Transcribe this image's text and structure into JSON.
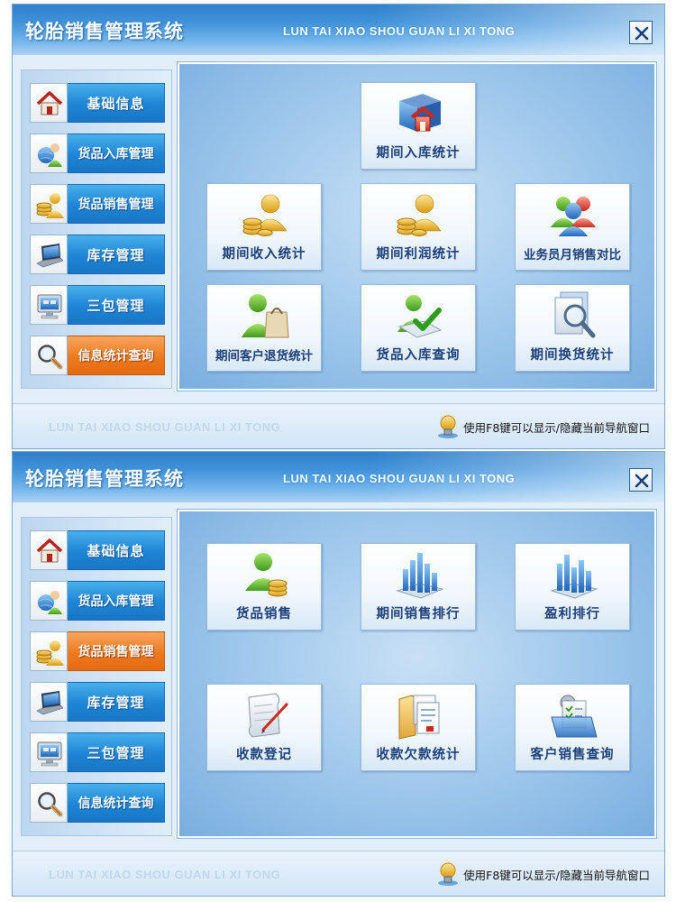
{
  "app": {
    "title": "轮胎销售管理系统",
    "subtitle": "LUN TAI XIAO SHOU GUAN LI XI TONG",
    "footer_brand": "LUN TAI XIAO SHOU GUAN LI XI TONG",
    "footer_hint": "使用F8键可以显示/隐藏当前导航窗口"
  },
  "sidebar": {
    "items": [
      {
        "label": "基础信息",
        "icon": "house-icon"
      },
      {
        "label": "货品入库管理",
        "icon": "user-globe-icon"
      },
      {
        "label": "货品销售管理",
        "icon": "coins-icon"
      },
      {
        "label": "库存管理",
        "icon": "laptop-icon"
      },
      {
        "label": "三包管理",
        "icon": "computer-monitor-icon"
      },
      {
        "label": "信息统计查询",
        "icon": "magnifier-icon"
      }
    ]
  },
  "window1": {
    "active_nav": "信息统计查询",
    "tiles": [
      {
        "label": "期间入库统计",
        "icon": "book-house-icon"
      },
      {
        "label": "期间收入统计",
        "icon": "user-coins-icon"
      },
      {
        "label": "期间利润统计",
        "icon": "user-coins-icon"
      },
      {
        "label": "业务员月销售对比",
        "icon": "user-group-icon"
      },
      {
        "label": "期间客户退货统计",
        "icon": "user-bag-icon"
      },
      {
        "label": "货品入库查询",
        "icon": "user-check-icon"
      },
      {
        "label": "期间换货统计",
        "icon": "document-search-icon"
      }
    ]
  },
  "window2": {
    "active_nav": "货品销售管理",
    "tiles": [
      {
        "label": "货品销售",
        "icon": "user-coins-icon"
      },
      {
        "label": "期间销售排行",
        "icon": "bar-chart-icon"
      },
      {
        "label": "盈利排行",
        "icon": "bar-chart-icon"
      },
      {
        "label": "收款登记",
        "icon": "scroll-pen-icon"
      },
      {
        "label": "收款欠款统计",
        "icon": "folder-documents-icon"
      },
      {
        "label": "客户销售查询",
        "icon": "folder-checklist-icon"
      }
    ]
  },
  "colors": {
    "nav_blue": "#1e84d4",
    "nav_active_orange": "#ee7a20",
    "tile_text": "#1c3f78",
    "panel_blue": "#9cc6eb"
  }
}
